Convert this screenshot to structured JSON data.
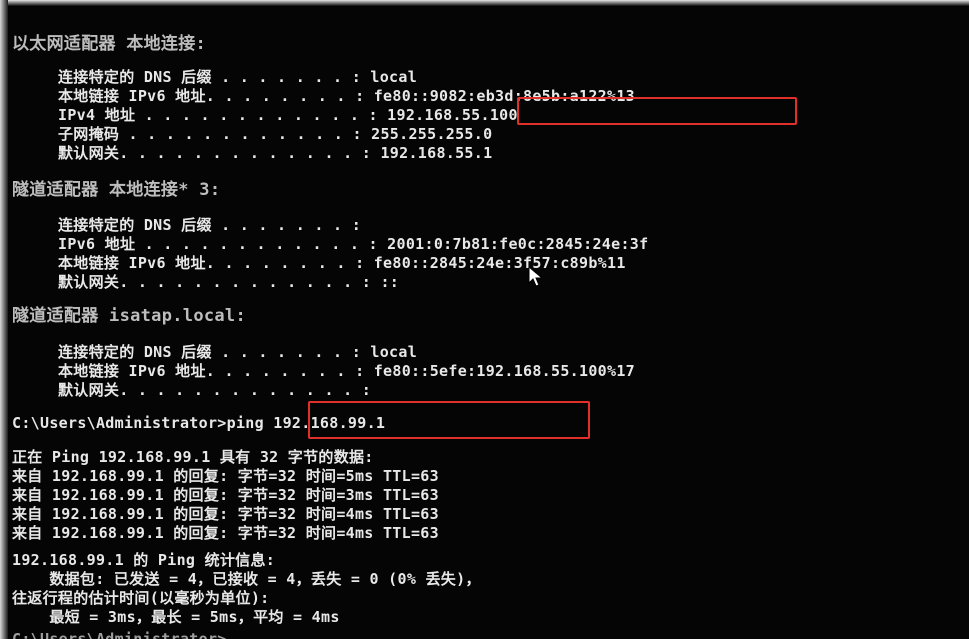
{
  "terminal": {
    "lines": [
      "以太网适配器 本地连接:",
      "   连接特定的 DNS 后缀 . . . . . . . : local",
      "   本地链接 IPv6 地址. . . . . . . . : fe80::9082:eb3d:8e5b:a122%13",
      "   IPv4 地址 . . . . . . . . . . . . : 192.168.55.100",
      "   子网掩码 . . . . . . . . . . . . : 255.255.255.0",
      "   默认网关. . . . . . . . . . . . . : 192.168.55.1",
      "隧道适配器 本地连接* 3:",
      "   连接特定的 DNS 后缀 . . . . . . . :",
      "   IPv6 地址 . . . . . . . . . . . . : 2001:0:7b81:fe0c:2845:24e:3f",
      "   本地链接 IPv6 地址. . . . . . . . : fe80::2845:24e:3f57:c89b%11",
      "   默认网关. . . . . . . . . . . . . : ::",
      "隧道适配器 isatap.local:",
      "   连接特定的 DNS 后缀 . . . . . . . : local",
      "   本地链接 IPv6 地址. . . . . . . . : fe80::5efe:192.168.55.100%17",
      "   默认网关. . . . . . . . . . . . . :",
      "C:\\Users\\Administrator>ping 192.168.99.1",
      "正在 Ping 192.168.99.1 具有 32 字节的数据:",
      "来自 192.168.99.1 的回复: 字节=32 时间=5ms TTL=63",
      "来自 192.168.99.1 的回复: 字节=32 时间=3ms TTL=63",
      "来自 192.168.99.1 的回复: 字节=32 时间=4ms TTL=63",
      "来自 192.168.99.1 的回复: 字节=32 时间=4ms TTL=63",
      "192.168.99.1 的 Ping 统计信息:",
      "    数据包: 已发送 = 4，已接收 = 4，丢失 = 0 (0% 丢失)，",
      "往返行程的估计时间(以毫秒为单位):",
      "    最短 = 3ms，最长 = 5ms，平均 = 4ms",
      "C:\\Users\\Administrator>"
    ]
  },
  "colors": {
    "background": "#050505",
    "text": "#e8e8e8",
    "highlight_border": "#e0302a"
  },
  "icons": {
    "cursor": "mouse-pointer-icon"
  }
}
